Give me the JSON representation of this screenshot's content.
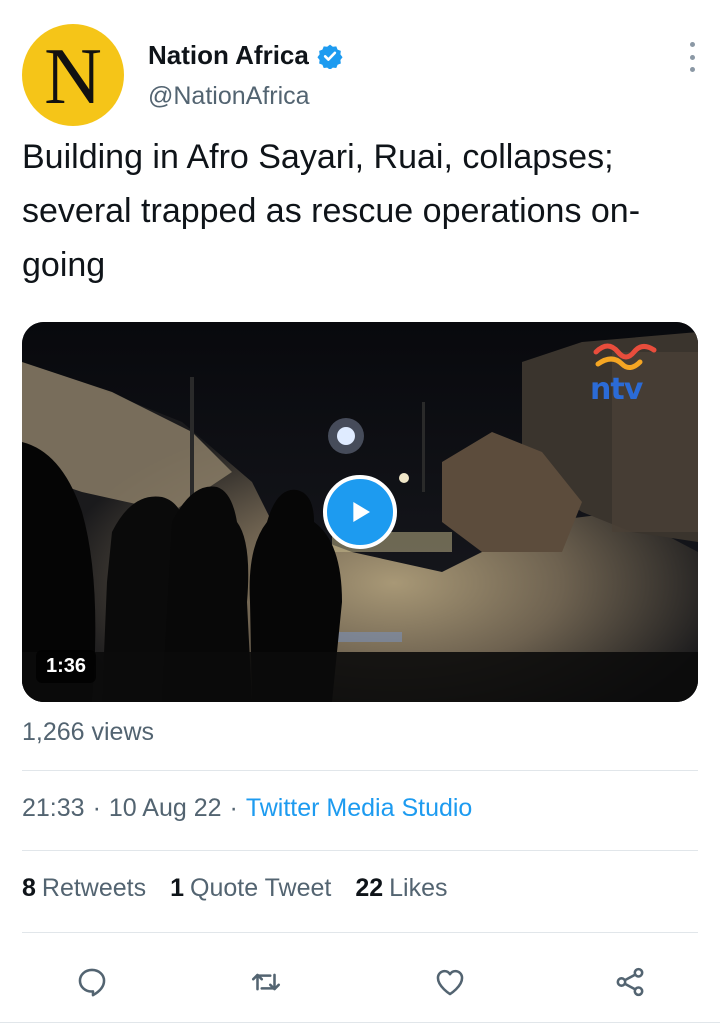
{
  "tweet": {
    "author": {
      "avatar_letter": "N",
      "display_name": "Nation Africa",
      "handle": "@NationAfrica",
      "verified": true
    },
    "text": "Building in Afro Sayari, Ruai, collapses; several trapped as rescue operations on-going",
    "media": {
      "type": "video",
      "duration": "1:36",
      "watermark": "ntv"
    },
    "views": "1,266 views",
    "time": "21:33",
    "date": "10 Aug 22",
    "separator": "·",
    "source": "Twitter Media Studio",
    "stats": {
      "retweets_count": "8",
      "retweets_label": "Retweets",
      "quotes_count": "1",
      "quotes_label": "Quote Tweet",
      "likes_count": "22",
      "likes_label": "Likes"
    },
    "actions": [
      "reply-icon",
      "retweet-icon",
      "like-icon",
      "share-icon"
    ]
  },
  "colors": {
    "accent": "#1d9bf0",
    "secondary_text": "#536471",
    "avatar_bg": "#f5c518"
  }
}
